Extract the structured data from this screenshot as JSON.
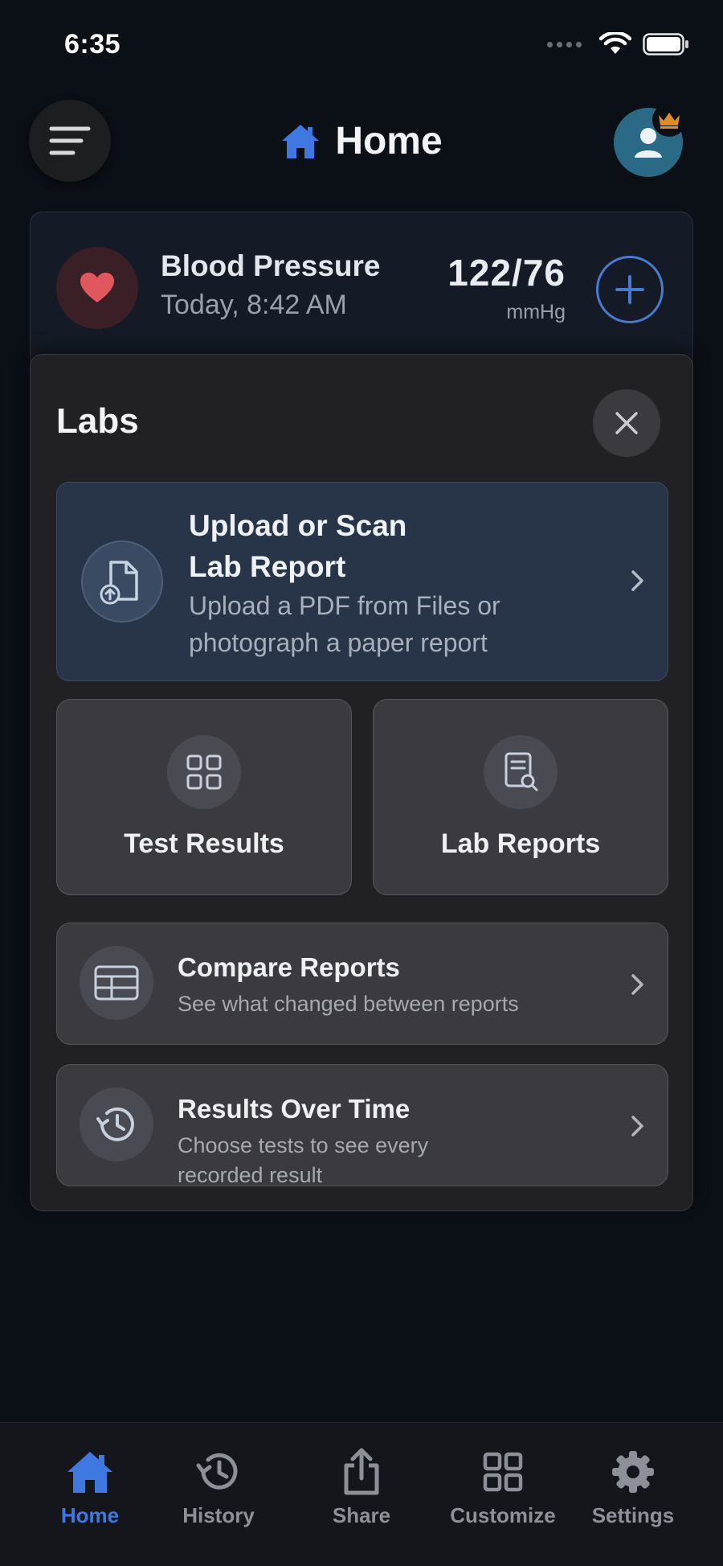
{
  "status_bar": {
    "time": "6:35"
  },
  "header": {
    "title": "Home"
  },
  "blood_pressure": {
    "title": "Blood Pressure",
    "time": "Today, 8:42 AM",
    "value": "122/76",
    "unit": "mmHg"
  },
  "labs": {
    "title": "Labs",
    "upload": {
      "title_line1": "Upload or Scan",
      "title_line2": "Lab Report",
      "description": "Upload a PDF from Files or photograph a paper report"
    },
    "tiles": [
      {
        "label": "Test Results",
        "icon": "grid-icon"
      },
      {
        "label": "Lab Reports",
        "icon": "document-search-icon"
      }
    ],
    "rows": [
      {
        "title": "Compare Reports",
        "description": "See what changed between reports",
        "icon": "table-icon"
      },
      {
        "title": "Results Over Time",
        "description": "Choose tests to see every recorded result",
        "icon": "history-icon"
      }
    ]
  },
  "tab_bar": {
    "items": [
      {
        "label": "Home",
        "icon": "home-icon",
        "active": true
      },
      {
        "label": "History",
        "icon": "history-icon",
        "active": false
      },
      {
        "label": "Share",
        "icon": "share-icon",
        "active": false
      },
      {
        "label": "Customize",
        "icon": "grid-icon",
        "active": false
      },
      {
        "label": "Settings",
        "icon": "gear-icon",
        "active": false
      }
    ]
  },
  "colors": {
    "accent": "#3f78e0",
    "heart": "#e0575e",
    "crown": "#e08a2a",
    "background": "#0b0f16"
  }
}
